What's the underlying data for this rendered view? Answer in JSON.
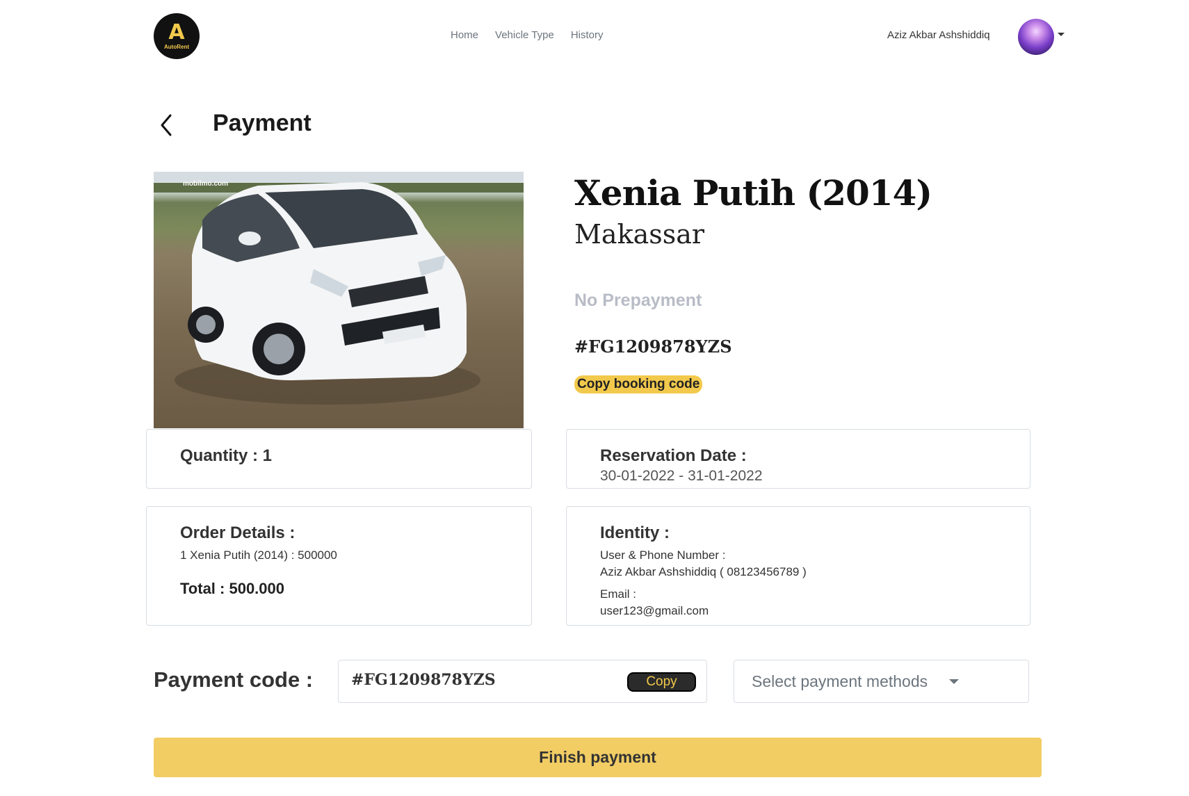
{
  "nav": {
    "logo_letter": "A",
    "logo_text": "AutoRent",
    "links": [
      "Home",
      "Vehicle Type",
      "History"
    ],
    "user_name": "Aziz Akbar Ashshiddiq"
  },
  "page": {
    "title": "Payment"
  },
  "vehicle": {
    "image_watermark": "mobilmo.com",
    "name": "Xenia Putih (2014)",
    "city": "Makassar",
    "prepayment": "No Prepayment",
    "booking_code": "#FG1209878YZS",
    "copy_booking_label": "Copy booking code"
  },
  "quantity": {
    "label": "Quantity : 1"
  },
  "reservation": {
    "heading": "Reservation Date :",
    "dates": "30-01-2022 - 31-01-2022"
  },
  "order": {
    "heading": "Order Details :",
    "line": "1 Xenia Putih (2014) : 500000",
    "total": "Total : 500.000"
  },
  "identity": {
    "heading": "Identity :",
    "user_label": "User & Phone Number :",
    "user_value": "Aziz Akbar Ashshiddiq ( 08123456789 )",
    "email_label": "Email :",
    "email_value": "user123@gmail.com"
  },
  "payment": {
    "label": "Payment code :",
    "code": "#FG1209878YZS",
    "copy_label": "Copy",
    "method_placeholder": "Select payment methods",
    "finish_label": "Finish payment"
  },
  "colors": {
    "accent": "#f2c94c",
    "finish_button": "#f2cd64",
    "muted": "#b7bcc6"
  }
}
